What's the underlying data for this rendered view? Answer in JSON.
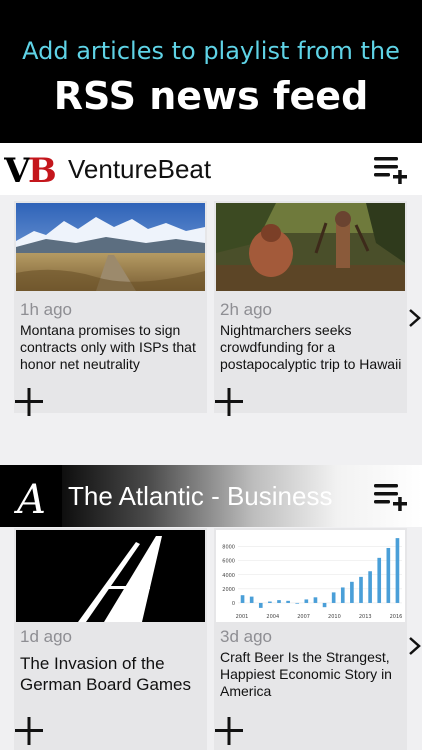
{
  "promo": {
    "subtitle": "Add articles to playlist from the",
    "title": "RSS news feed"
  },
  "feeds": [
    {
      "name": "VentureBeat",
      "logo_text": "VB",
      "articles": [
        {
          "time": "1h ago",
          "headline": "Montana promises to sign contracts only with ISPs that honor net neutrality"
        },
        {
          "time": "2h ago",
          "headline": "Nightmarchers seeks crowdfunding for a postapocalyptic trip to Hawaii"
        }
      ]
    },
    {
      "name": "The Atlantic - Business",
      "logo_text": "A",
      "articles": [
        {
          "time": "1d ago",
          "headline": "The Invasion of the German Board Games"
        },
        {
          "time": "3d ago",
          "headline": "Craft Beer Is the Strangest, Happiest Economic Story in America",
          "thumb_chart": {
            "type": "bar",
            "x_ticks": [
              "2001",
              "2004",
              "2007",
              "2010",
              "2013",
              "2016"
            ],
            "y_ticks": [
              "0",
              "2000",
              "4000",
              "6000",
              "8000"
            ],
            "values": [
              1100,
              900,
              -700,
              200,
              400,
              300,
              -100,
              500,
              800,
              -600,
              1500,
              2200,
              3000,
              3700,
              4500,
              6400,
              7800,
              9200
            ]
          }
        }
      ]
    }
  ],
  "icons": {
    "add_to_playlist": "playlist-add-icon",
    "add": "plus-icon",
    "next": "chevron-right-icon"
  },
  "colors": {
    "accent": "#5fd3e6",
    "bar": "#4a9fd8"
  }
}
